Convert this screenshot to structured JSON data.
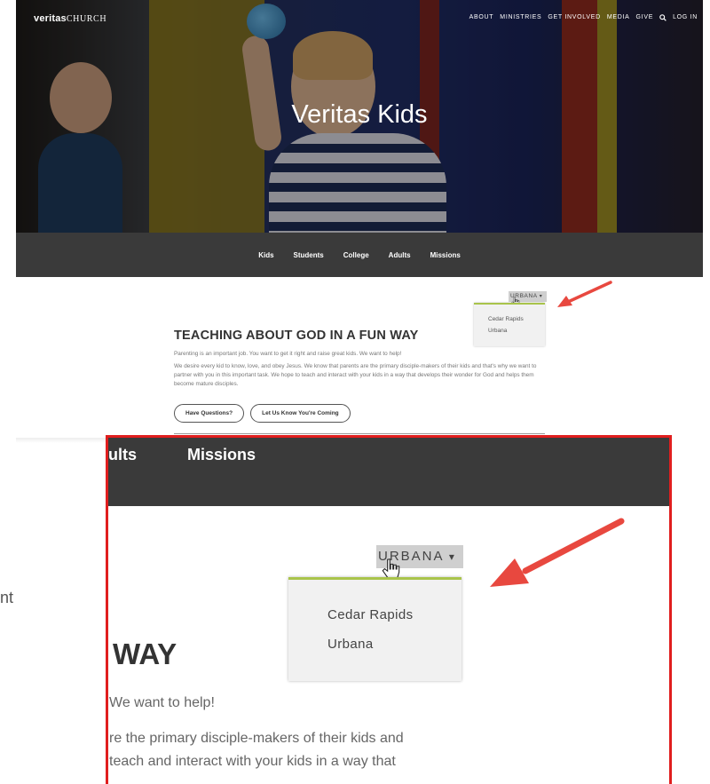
{
  "site": {
    "logo_bold": "veritas",
    "logo_light": "CHURCH",
    "top_nav": [
      "ABOUT",
      "MINISTRIES",
      "GET INVOLVED",
      "MEDIA",
      "GIVE",
      "LOG IN"
    ],
    "hero_title": "Veritas Kids",
    "sub_nav": [
      "Kids",
      "Students",
      "College",
      "Adults",
      "Missions"
    ]
  },
  "location_selector": {
    "current": "URBANA",
    "options": [
      "Cedar Rapids",
      "Urbana"
    ]
  },
  "content": {
    "heading": "TEACHING ABOUT GOD IN A FUN WAY",
    "intro": "Parenting is an important job. You want to get it right and raise great kids. We want to help!",
    "body": "We desire every kid to know, love, and obey Jesus. We know that parents are the primary disciple-makers of their kids and that's why we want to partner with you in this important task. We hope to teach and interact with your kids in a way that develops their wonder for God and helps them become mature disciples.",
    "button_questions": "Have Questions?",
    "button_coming": "Let Us Know You're Coming"
  },
  "zoom": {
    "nav_partial_1": "ults",
    "nav_partial_2": "Missions",
    "location": "URBANA",
    "options": [
      "Cedar Rapids",
      "Urbana"
    ],
    "heading_partial": "WAY",
    "line1": "We want to help!",
    "line2": "re the primary disciple-makers of their kids and",
    "line3": "teach and interact with your kids in a way that",
    "outside_text": "nt"
  },
  "colors": {
    "accent_green": "#a9c44b",
    "callout_red": "#e01e1e",
    "arrow_red": "#e8483f",
    "nav_dark": "#3a3a3a"
  }
}
